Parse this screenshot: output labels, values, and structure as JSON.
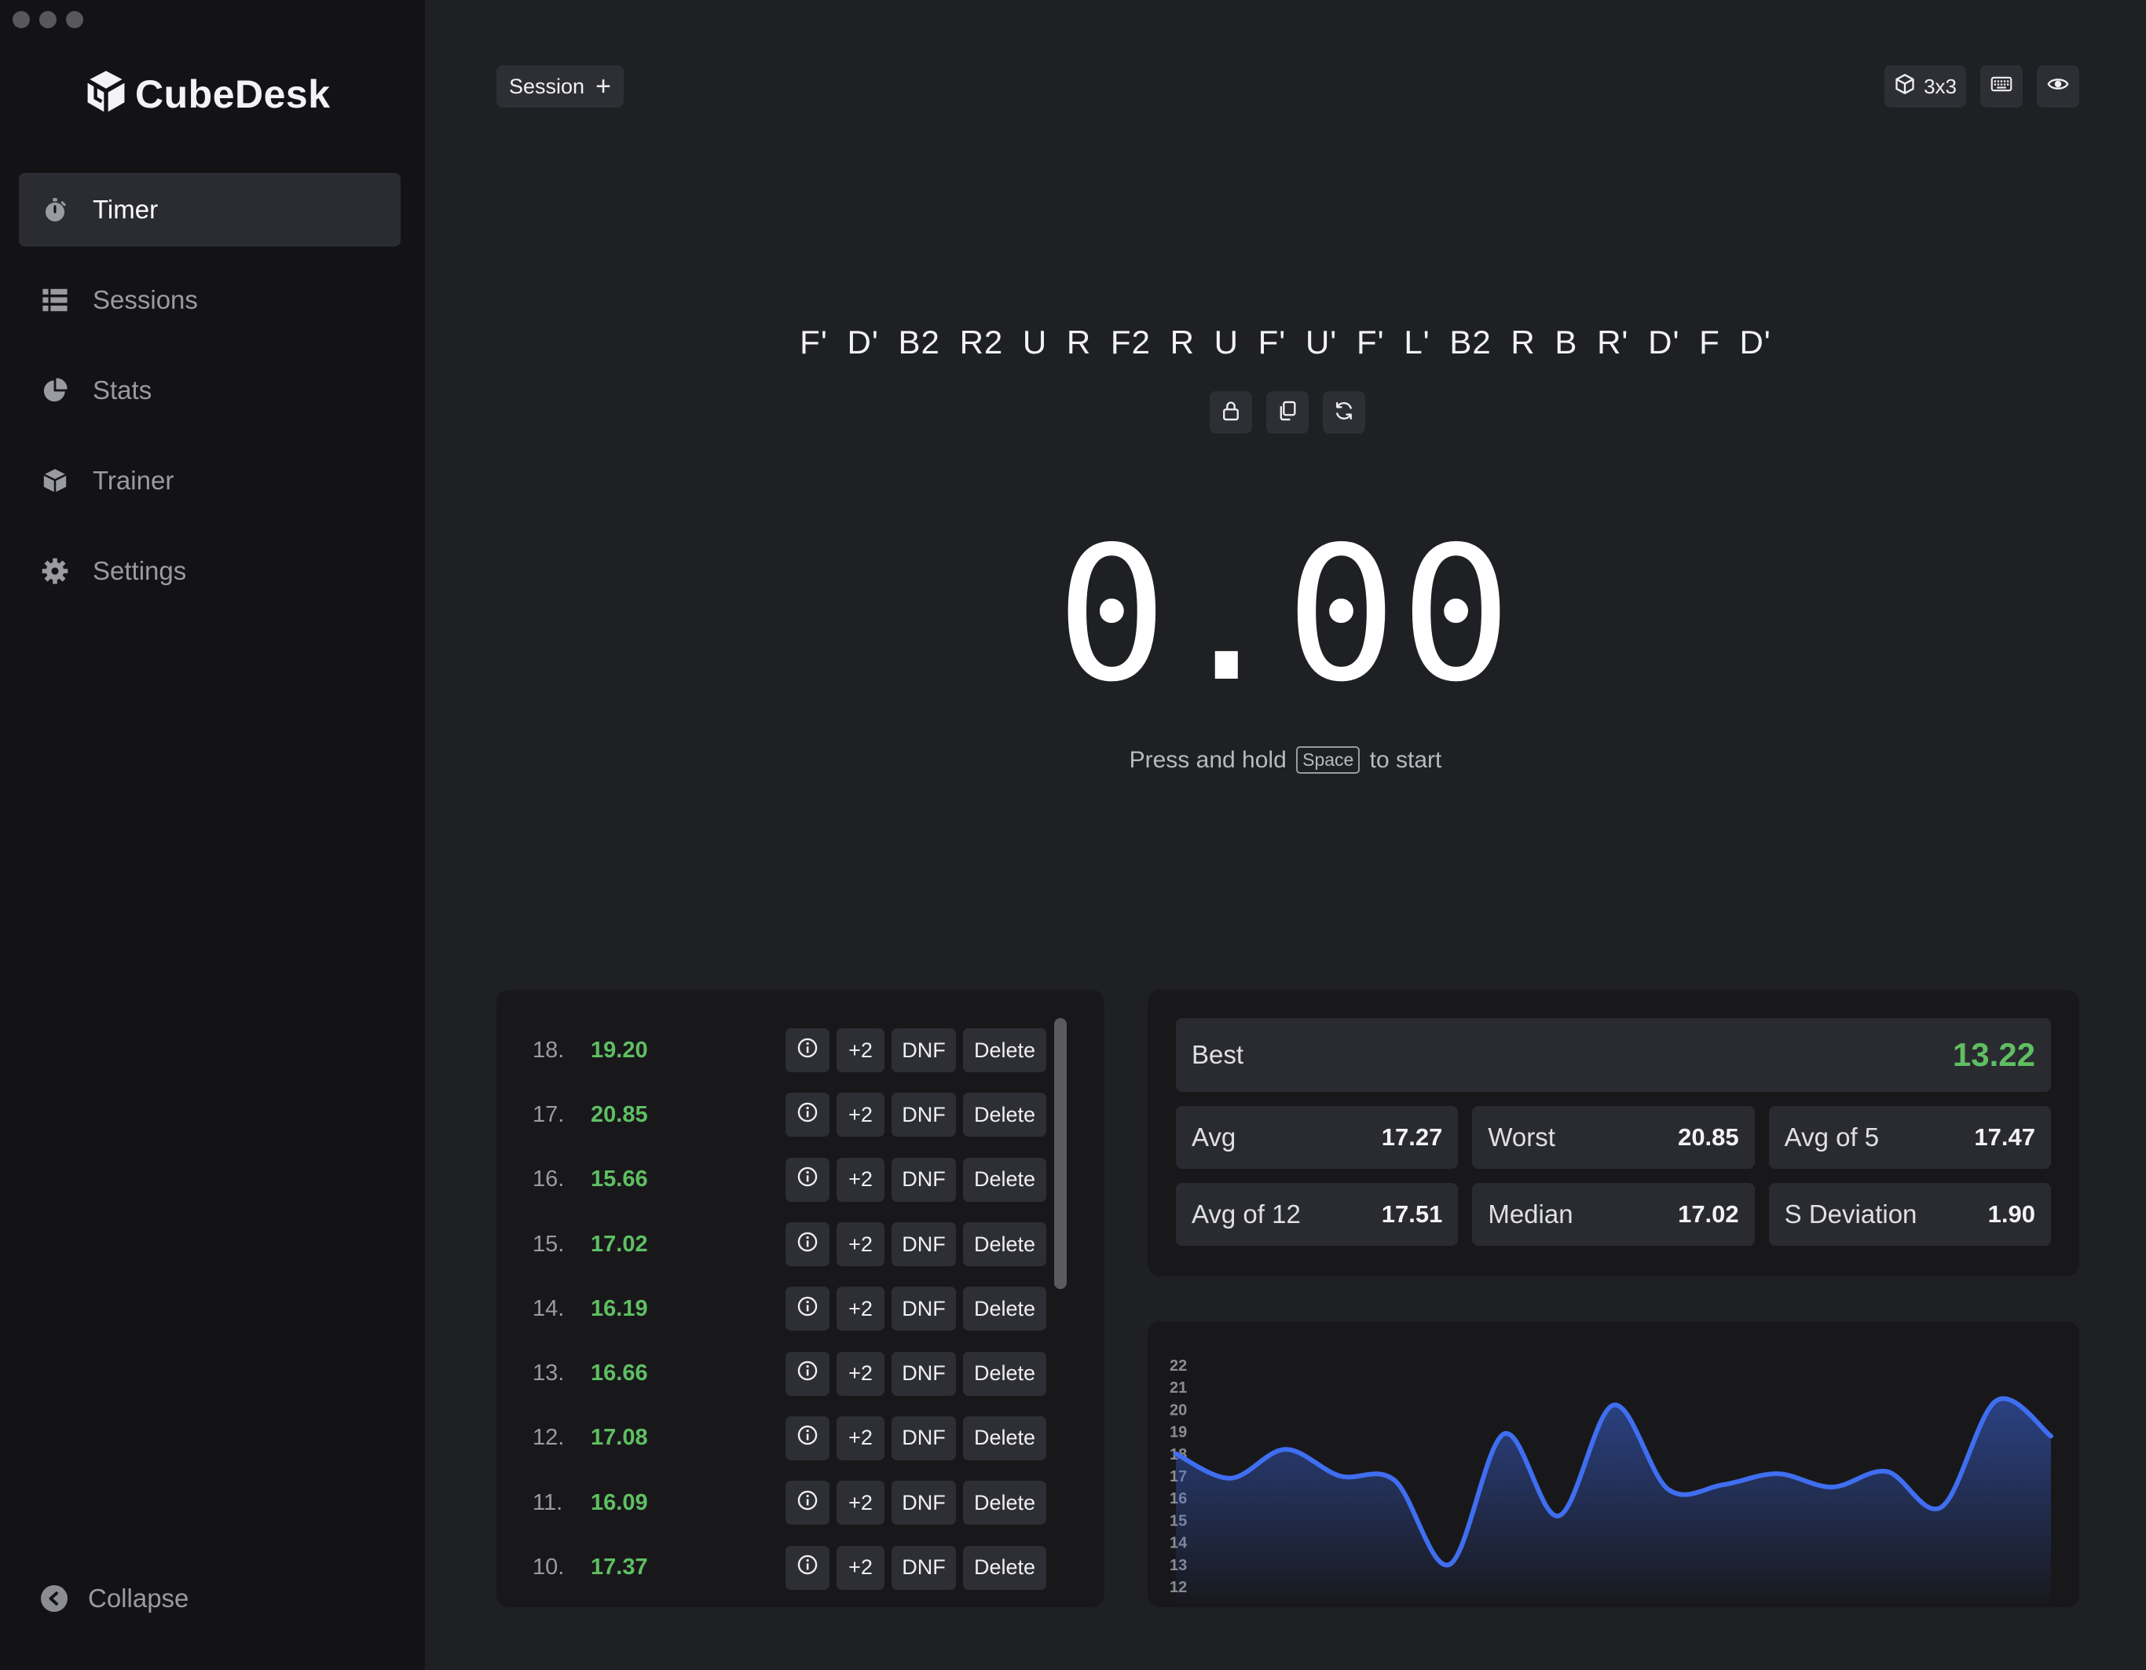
{
  "app": {
    "name": "CubeDesk"
  },
  "sidebar": {
    "items": [
      {
        "label": "Timer",
        "icon": "stopwatch-icon",
        "active": true
      },
      {
        "label": "Sessions",
        "icon": "list-icon",
        "active": false
      },
      {
        "label": "Stats",
        "icon": "pie-chart-icon",
        "active": false
      },
      {
        "label": "Trainer",
        "icon": "cube-icon",
        "active": false
      },
      {
        "label": "Settings",
        "icon": "gear-icon",
        "active": false
      }
    ],
    "collapse_label": "Collapse"
  },
  "topbar": {
    "session_label": "Session",
    "cube_type": "3x3"
  },
  "scramble": "F' D' B2 R2 U R F2 R U F' U' F' L' B2 R B R' D' F D'",
  "timer": {
    "value": "0.00",
    "hint_before": "Press and hold",
    "hint_key": "Space",
    "hint_after": "to start"
  },
  "solves": {
    "action_labels": {
      "plus2": "+2",
      "dnf": "DNF",
      "delete": "Delete"
    },
    "rows": [
      {
        "num": "18.",
        "time": "19.20"
      },
      {
        "num": "17.",
        "time": "20.85"
      },
      {
        "num": "16.",
        "time": "15.66"
      },
      {
        "num": "15.",
        "time": "17.02"
      },
      {
        "num": "14.",
        "time": "16.19"
      },
      {
        "num": "13.",
        "time": "16.66"
      },
      {
        "num": "12.",
        "time": "17.08"
      },
      {
        "num": "11.",
        "time": "16.09"
      },
      {
        "num": "10.",
        "time": "17.37"
      }
    ]
  },
  "stats": {
    "best": {
      "label": "Best",
      "value": "13.22"
    },
    "cells": [
      {
        "label": "Avg",
        "value": "17.27"
      },
      {
        "label": "Worst",
        "value": "20.85"
      },
      {
        "label": "Avg of 5",
        "value": "17.47"
      },
      {
        "label": "Avg of 12",
        "value": "17.51"
      },
      {
        "label": "Median",
        "value": "17.02"
      },
      {
        "label": "S Deviation",
        "value": "1.90"
      }
    ]
  },
  "colors": {
    "accent_green": "#5fbf62",
    "chart_line": "#3f6ef0",
    "sidebar_bg": "#131316",
    "main_bg": "#1f2024"
  },
  "chart_data": {
    "type": "area",
    "title": "",
    "xlabel": "",
    "ylabel": "",
    "ylim": [
      12,
      22
    ],
    "yticks": [
      22,
      21,
      20,
      19,
      18,
      17,
      16,
      15,
      14,
      13,
      12
    ],
    "series": [
      {
        "values": [
          18.0,
          16.9,
          18.2,
          17.0,
          16.8,
          13.0,
          18.9,
          15.2,
          20.2,
          16.4,
          16.6,
          17.1,
          16.5,
          17.2,
          15.6,
          20.4,
          18.8
        ]
      }
    ],
    "grid": false,
    "legend": "none"
  }
}
